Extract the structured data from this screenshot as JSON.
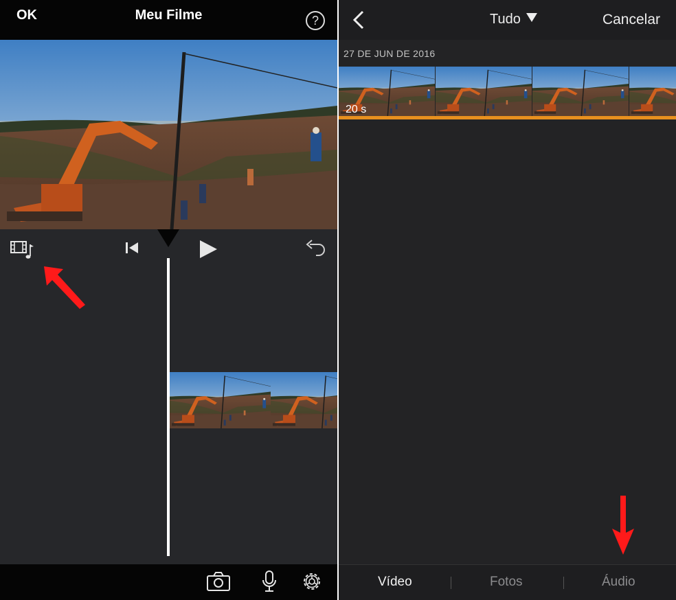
{
  "left": {
    "header": {
      "ok_label": "OK",
      "title": "Meu Filme",
      "help_glyph": "?"
    },
    "toolbar": {
      "media_icon": "film-music-icon",
      "skip_icon": "skip-to-start-icon",
      "play_icon": "play-icon",
      "undo_icon": "undo-icon"
    },
    "bottom": {
      "camera_icon": "camera-icon",
      "mic_icon": "microphone-icon",
      "settings_icon": "gear-icon"
    },
    "annotation_arrow_color": "#ff1a1a"
  },
  "right": {
    "header": {
      "back_icon": "chevron-left-icon",
      "filter_label": "Tudo",
      "cancel_label": "Cancelar"
    },
    "section": {
      "date": "27 DE JUN DE 2016"
    },
    "clip": {
      "duration": "20 s",
      "selection_color": "#e8901e"
    },
    "tabs": [
      {
        "label": "Vídeo",
        "selected": true
      },
      {
        "label": "Fotos",
        "selected": false
      },
      {
        "label": "Áudio",
        "selected": false
      }
    ]
  }
}
